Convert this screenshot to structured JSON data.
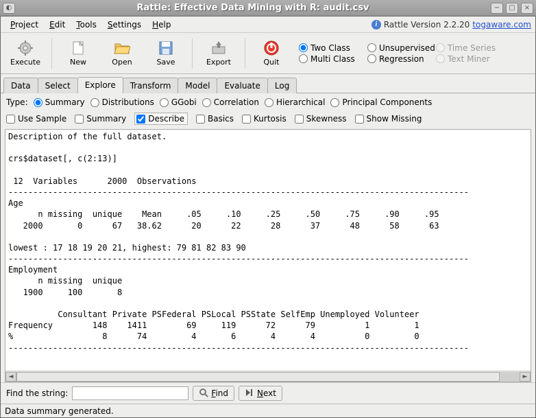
{
  "titlebar": {
    "title": "Rattle: Effective Data Mining with R: audit.csv"
  },
  "menubar": {
    "items": [
      "Project",
      "Edit",
      "Tools",
      "Settings",
      "Help"
    ],
    "version_prefix": "Rattle Version 2.2.20",
    "version_link": "togaware.com"
  },
  "toolbar": {
    "execute": "Execute",
    "new": "New",
    "open": "Open",
    "save": "Save",
    "export": "Export",
    "quit": "Quit",
    "radios": {
      "two_class": "Two Class",
      "unsupervised": "Unsupervised",
      "time_series": "Time Series",
      "multi_class": "Multi Class",
      "regression": "Regression",
      "text_miner": "Text Miner"
    }
  },
  "tabs": [
    "Data",
    "Select",
    "Explore",
    "Transform",
    "Model",
    "Evaluate",
    "Log"
  ],
  "active_tab": "Explore",
  "type_row": {
    "label": "Type:",
    "options": [
      "Summary",
      "Distributions",
      "GGobi",
      "Correlation",
      "Hierarchical",
      "Principal Components"
    ],
    "selected": "Summary"
  },
  "check_row": {
    "use_sample": "Use Sample",
    "summary": "Summary",
    "describe": "Describe",
    "basics": "Basics",
    "kurtosis": "Kurtosis",
    "skewness": "Skewness",
    "show_missing": "Show Missing"
  },
  "output_text": "Description of the full dataset.\n\ncrs$dataset[, c(2:13)]\n\n 12  Variables      2000  Observations\n---------------------------------------------------------------------------------------------\nAge \n      n missing  unique    Mean     .05     .10     .25     .50     .75     .90     .95 \n   2000       0      67   38.62      20      22      28      37      48      58      63 \n\nlowest : 17 18 19 20 21, highest: 79 81 82 83 90 \n---------------------------------------------------------------------------------------------\nEmployment \n      n missing  unique \n   1900     100       8 \n\n          Consultant Private PSFederal PSLocal PSState SelfEmp Unemployed Volunteer\nFrequency        148    1411        69     119      72      79          1         1\n%                  8      74         4       6       4       4          0         0\n---------------------------------------------------------------------------------------------",
  "findbar": {
    "label": "Find the string:",
    "value": "",
    "find": "Find",
    "next": "Next"
  },
  "statusbar": {
    "text": "Data summary generated."
  }
}
